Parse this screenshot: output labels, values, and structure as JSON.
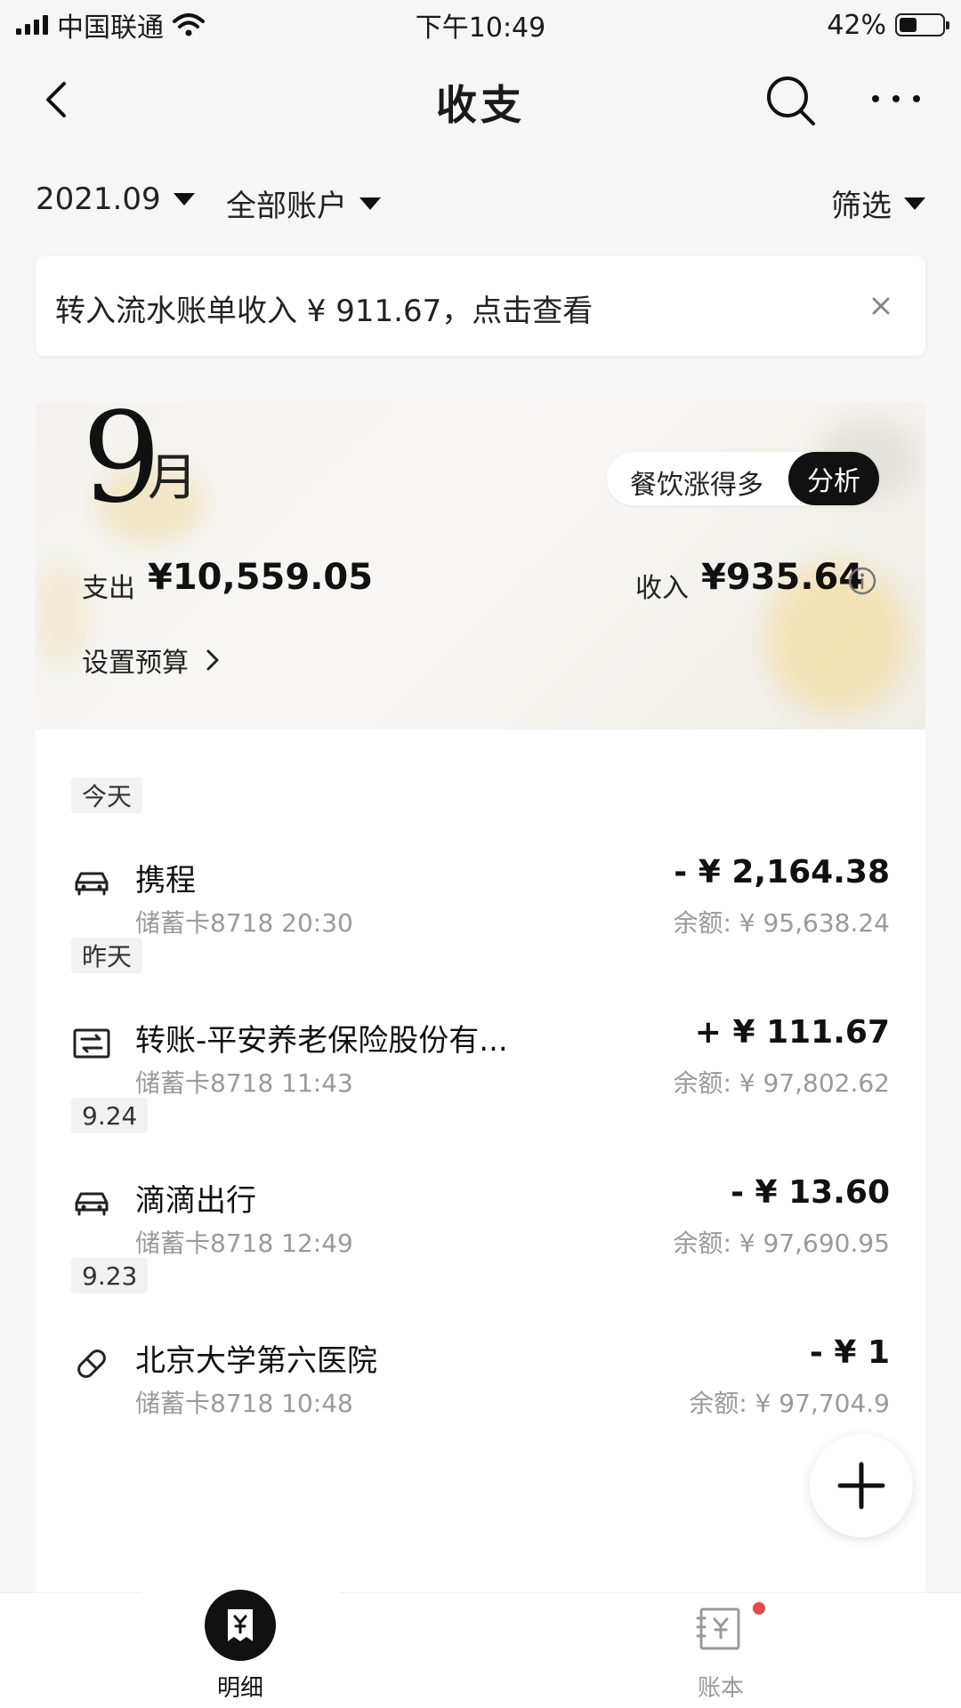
{
  "status_bar": {
    "carrier": "中国联通",
    "time": "下午10:49",
    "battery": "42%",
    "battery_level": 0.42
  },
  "header": {
    "title": "收支",
    "back_icon": "chevron-left-icon",
    "search_icon": "search-icon",
    "more_icon": "more-icon"
  },
  "filters": {
    "month": "2021.09",
    "account": "全部账户",
    "filter_label": "筛选"
  },
  "notice": {
    "text": "转入流水账单收入 ¥ 911.67，点击查看",
    "close_icon": "close-icon"
  },
  "summary": {
    "month_number": "9",
    "month_unit": "月",
    "analysis_hint": "餐饮涨得多",
    "analysis_button": "分析",
    "spend_label": "支出",
    "spend_value": "¥10,559.05",
    "income_label": "收入",
    "income_value": "¥935.64",
    "budget_label": "设置预算"
  },
  "days": [
    {
      "label": "今天",
      "transactions": [
        {
          "icon": "car-icon",
          "name": "携程",
          "sub": "储蓄卡8718 20:30",
          "amount": "- ¥ 2,164.38",
          "balance": "余额: ¥ 95,638.24"
        }
      ]
    },
    {
      "label": "昨天",
      "transactions": [
        {
          "icon": "transfer-icon",
          "name": "转账-平安养老保险股份有...",
          "sub": "储蓄卡8718 11:43",
          "amount": "+ ¥ 111.67",
          "balance": "余额: ¥ 97,802.62"
        }
      ]
    },
    {
      "label": "9.24",
      "transactions": [
        {
          "icon": "car-icon",
          "name": "滴滴出行",
          "sub": "储蓄卡8718 12:49",
          "amount": "- ¥ 13.60",
          "balance": "余额: ¥ 97,690.95"
        }
      ]
    },
    {
      "label": "9.23",
      "transactions": [
        {
          "icon": "pill-icon",
          "name": "北京大学第六医院",
          "sub": "储蓄卡8718 10:48",
          "amount": "- ¥ 1",
          "balance": "余额: ¥ 97,704.9"
        }
      ]
    }
  ],
  "fab": {
    "icon": "plus-icon"
  },
  "tabs": [
    {
      "label": "明细",
      "icon": "receipt-icon",
      "active": true
    },
    {
      "label": "账本",
      "icon": "ledger-icon",
      "active": false
    }
  ],
  "colors": {
    "accent": "#111111",
    "badge": "#e8474b",
    "muted": "#9a9a9a"
  }
}
